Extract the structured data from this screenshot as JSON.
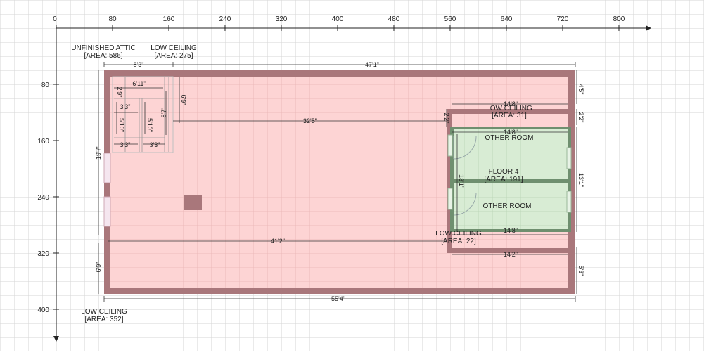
{
  "ruler": {
    "x_ticks": [
      "0",
      "80",
      "160",
      "240",
      "320",
      "400",
      "480",
      "560",
      "640",
      "720",
      "800"
    ],
    "y_ticks": [
      "80",
      "160",
      "240",
      "320",
      "400"
    ]
  },
  "rooms": {
    "unfinished_attic": {
      "name": "UNFINISHED ATTIC",
      "area": "[AREA: 586]"
    },
    "low_ceiling_top_left": {
      "name": "LOW CEILING",
      "area": "[AREA: 275]"
    },
    "low_ceiling_top_right": {
      "name": "LOW CEILING",
      "area": "[AREA: 31]"
    },
    "low_ceiling_bottom_right": {
      "name": "LOW CEILING",
      "area": "[AREA: 22]"
    },
    "low_ceiling_bottom_left": {
      "name": "LOW CEILING",
      "area": "[AREA: 352]"
    },
    "other_room_top": {
      "name": "OTHER ROOM"
    },
    "floor_4": {
      "name": "FLOOR 4",
      "area": "[AREA: 191]"
    },
    "other_room_bottom": {
      "name": "OTHER ROOM"
    }
  },
  "dimensions": {
    "top_left": "8'3\"",
    "top_main": "47'1\"",
    "stair_width": "6'11\"",
    "stair_top": "2'9\"",
    "stair_height": "6'9\"",
    "stair_inner": "8'7\"",
    "stair_step_a": "3'3\"",
    "stair_step_b": "3'3\"",
    "stair_step_c": "3'3\"",
    "stair_v_a": "5'10\"",
    "stair_v_b": "5'10\"",
    "middle": "32'5\"",
    "right_top": "14'8\"",
    "right_gap": "2'2\"",
    "right_room_top": "14'8\"",
    "right_room_bottom": "14'8\"",
    "right_room_height": "13'1\"",
    "bottom_right": "14'2\"",
    "left_height": "19'7\"",
    "left_lower": "6'9\"",
    "long_inner": "41'2\"",
    "bottom_total": "55'4\"",
    "r_side_top": "4'5\"",
    "r_side_2": "2'2\"",
    "r_side_3": "13'1\"",
    "r_side_bottom": "5'3\""
  },
  "colors": {
    "attic_fill": "#fdd4d4",
    "wall": "#a9777b",
    "room_fill": "#d8ecd4",
    "room_wall": "#6f8f6f",
    "grid": "#d4d4d4",
    "axis": "#222222"
  }
}
